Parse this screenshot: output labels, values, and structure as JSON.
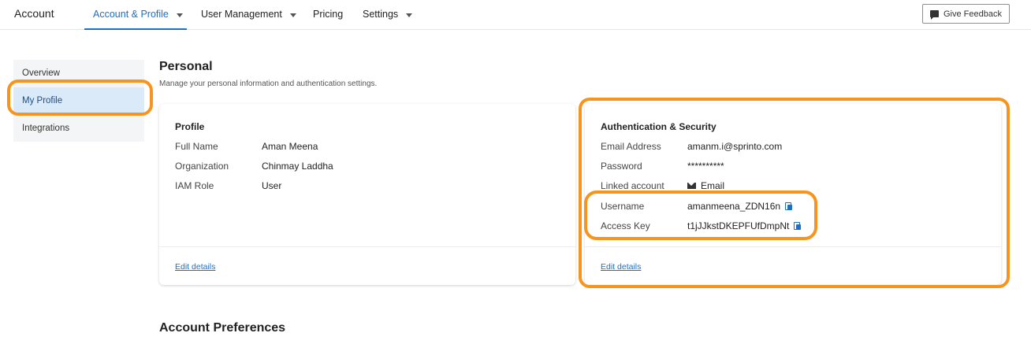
{
  "app": {
    "title": "Account"
  },
  "nav": {
    "items": [
      {
        "label": "Account & Profile"
      },
      {
        "label": "User Management"
      },
      {
        "label": "Pricing"
      },
      {
        "label": "Settings"
      }
    ],
    "feedback_label": "Give Feedback"
  },
  "sidebar": {
    "items": [
      {
        "label": "Overview"
      },
      {
        "label": "My Profile"
      },
      {
        "label": "Integrations"
      }
    ]
  },
  "personal": {
    "title": "Personal",
    "subtitle": "Manage your personal information and authentication settings."
  },
  "profile_card": {
    "heading": "Profile",
    "rows": [
      {
        "label": "Full Name",
        "value": "Aman Meena"
      },
      {
        "label": "Organization",
        "value": "Chinmay Laddha"
      },
      {
        "label": "IAM Role",
        "value": "User"
      }
    ],
    "edit_label": "Edit details"
  },
  "auth_card": {
    "heading": "Authentication & Security",
    "rows": [
      {
        "label": "Email Address",
        "value": "amanm.i@sprinto.com"
      },
      {
        "label": "Password",
        "value": "**********"
      },
      {
        "label": "Linked account",
        "value": "Email"
      },
      {
        "label": "Username",
        "value": "amanmeena_ZDN16n"
      },
      {
        "label": "Access Key",
        "value": "t1jJJkstDKEPFUfDmpNt"
      }
    ],
    "edit_label": "Edit details"
  },
  "preferences": {
    "title": "Account Preferences"
  },
  "colors": {
    "accent": "#1a6fc9",
    "highlight": "#f7941d",
    "active_bg": "#dbeaf8"
  },
  "icons": [
    "feedback-icon",
    "chevron-down-icon",
    "mail-icon",
    "copy-icon"
  ]
}
